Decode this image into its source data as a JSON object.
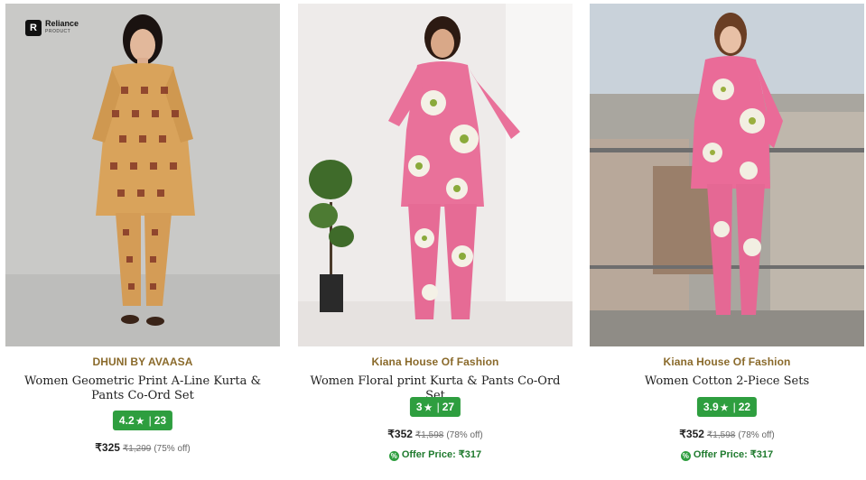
{
  "products": [
    {
      "badge": {
        "line1": "Reliance",
        "line2": "PRODUCT",
        "mark": "R"
      },
      "brand": "DHUNI BY AVAASA",
      "title": "Women Geometric Print A-Line Kurta & Pants Co-Ord Set",
      "rating": "4.2",
      "rating_count": "23",
      "price": "₹325",
      "mrp": "₹1,299",
      "discount": "(75% off)",
      "image_icon": "model-photo-mustard-print"
    },
    {
      "brand": "Kiana House Of Fashion",
      "title": "Women Floral print Kurta & Pants Co-Ord Set",
      "rating": "3",
      "rating_count": "27",
      "price": "₹352",
      "mrp": "₹1,598",
      "discount": "(78% off)",
      "offer": "Offer Price: ₹317",
      "image_icon": "model-photo-pink-floral-studio"
    },
    {
      "brand": "Kiana House Of Fashion",
      "title": "Women Cotton 2-Piece Sets",
      "rating": "3.9",
      "rating_count": "22",
      "price": "₹352",
      "mrp": "₹1,598",
      "discount": "(78% off)",
      "offer": "Offer Price: ₹317",
      "image_icon": "model-photo-pink-floral-balcony"
    }
  ],
  "symbols": {
    "star": "★",
    "separator": "|",
    "offer_icon": "%"
  },
  "colors": {
    "brand_text": "#8a6a2b",
    "rating_bg": "#2e9e3f",
    "offer_text": "#1f7a2e"
  }
}
